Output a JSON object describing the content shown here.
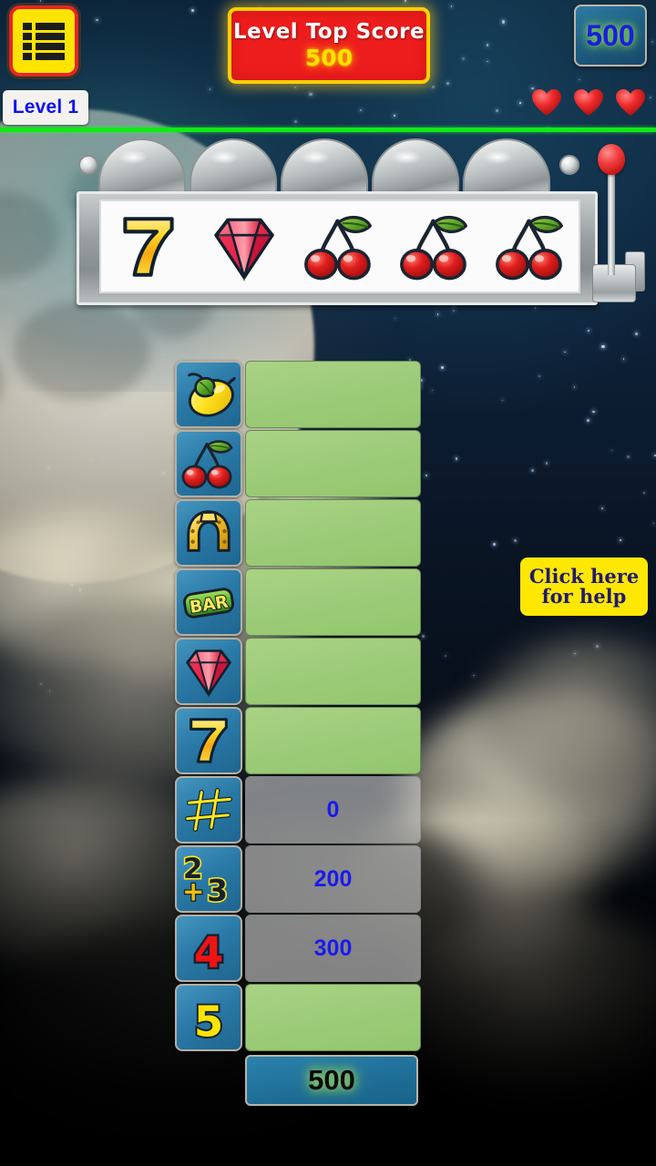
{
  "hud": {
    "menu_icon": "list-menu-icon",
    "level_label": "Level 1",
    "top_score": {
      "title": "Level Top Score",
      "value": "500"
    },
    "score_box": {
      "value": "500"
    },
    "lives": {
      "count": 3,
      "icon": "heart-icon"
    },
    "divider_color": "#12e818"
  },
  "slot_machine": {
    "reels": [
      {
        "symbol": "seven-icon",
        "label": "7"
      },
      {
        "symbol": "diamond-icon",
        "label": "Diamond"
      },
      {
        "symbol": "cherries-icon",
        "label": "Cherries"
      },
      {
        "symbol": "cherries-icon",
        "label": "Cherries"
      },
      {
        "symbol": "cherries-icon",
        "label": "Cherries"
      }
    ],
    "lever": {
      "knob_color": "#e03030",
      "name": "pull-lever"
    }
  },
  "paytable": {
    "rows": [
      {
        "icon": "lemon-icon",
        "value": "",
        "state": "green"
      },
      {
        "icon": "cherries-icon",
        "value": "",
        "state": "green"
      },
      {
        "icon": "horseshoe-icon",
        "value": "",
        "state": "green"
      },
      {
        "icon": "bar-icon",
        "value": "",
        "state": "green"
      },
      {
        "icon": "diamond-icon",
        "value": "",
        "state": "green"
      },
      {
        "icon": "seven-icon",
        "value": "",
        "state": "green"
      },
      {
        "icon": "no-match-icon",
        "value": "0",
        "state": "grey"
      },
      {
        "icon": "two-plus-three-icon",
        "value": "200",
        "state": "grey"
      },
      {
        "icon": "four-icon",
        "value": "300",
        "state": "grey"
      },
      {
        "icon": "five-icon",
        "value": "",
        "state": "green"
      }
    ],
    "total": "500"
  },
  "help": {
    "line1": "Click here",
    "line2": "for help"
  },
  "colors": {
    "accent_yellow": "#ffe800",
    "accent_red": "#ee1d1d",
    "tile_blue": "#2a79a6",
    "cell_green": "#9ccb77",
    "value_blue": "#1a1aee"
  }
}
